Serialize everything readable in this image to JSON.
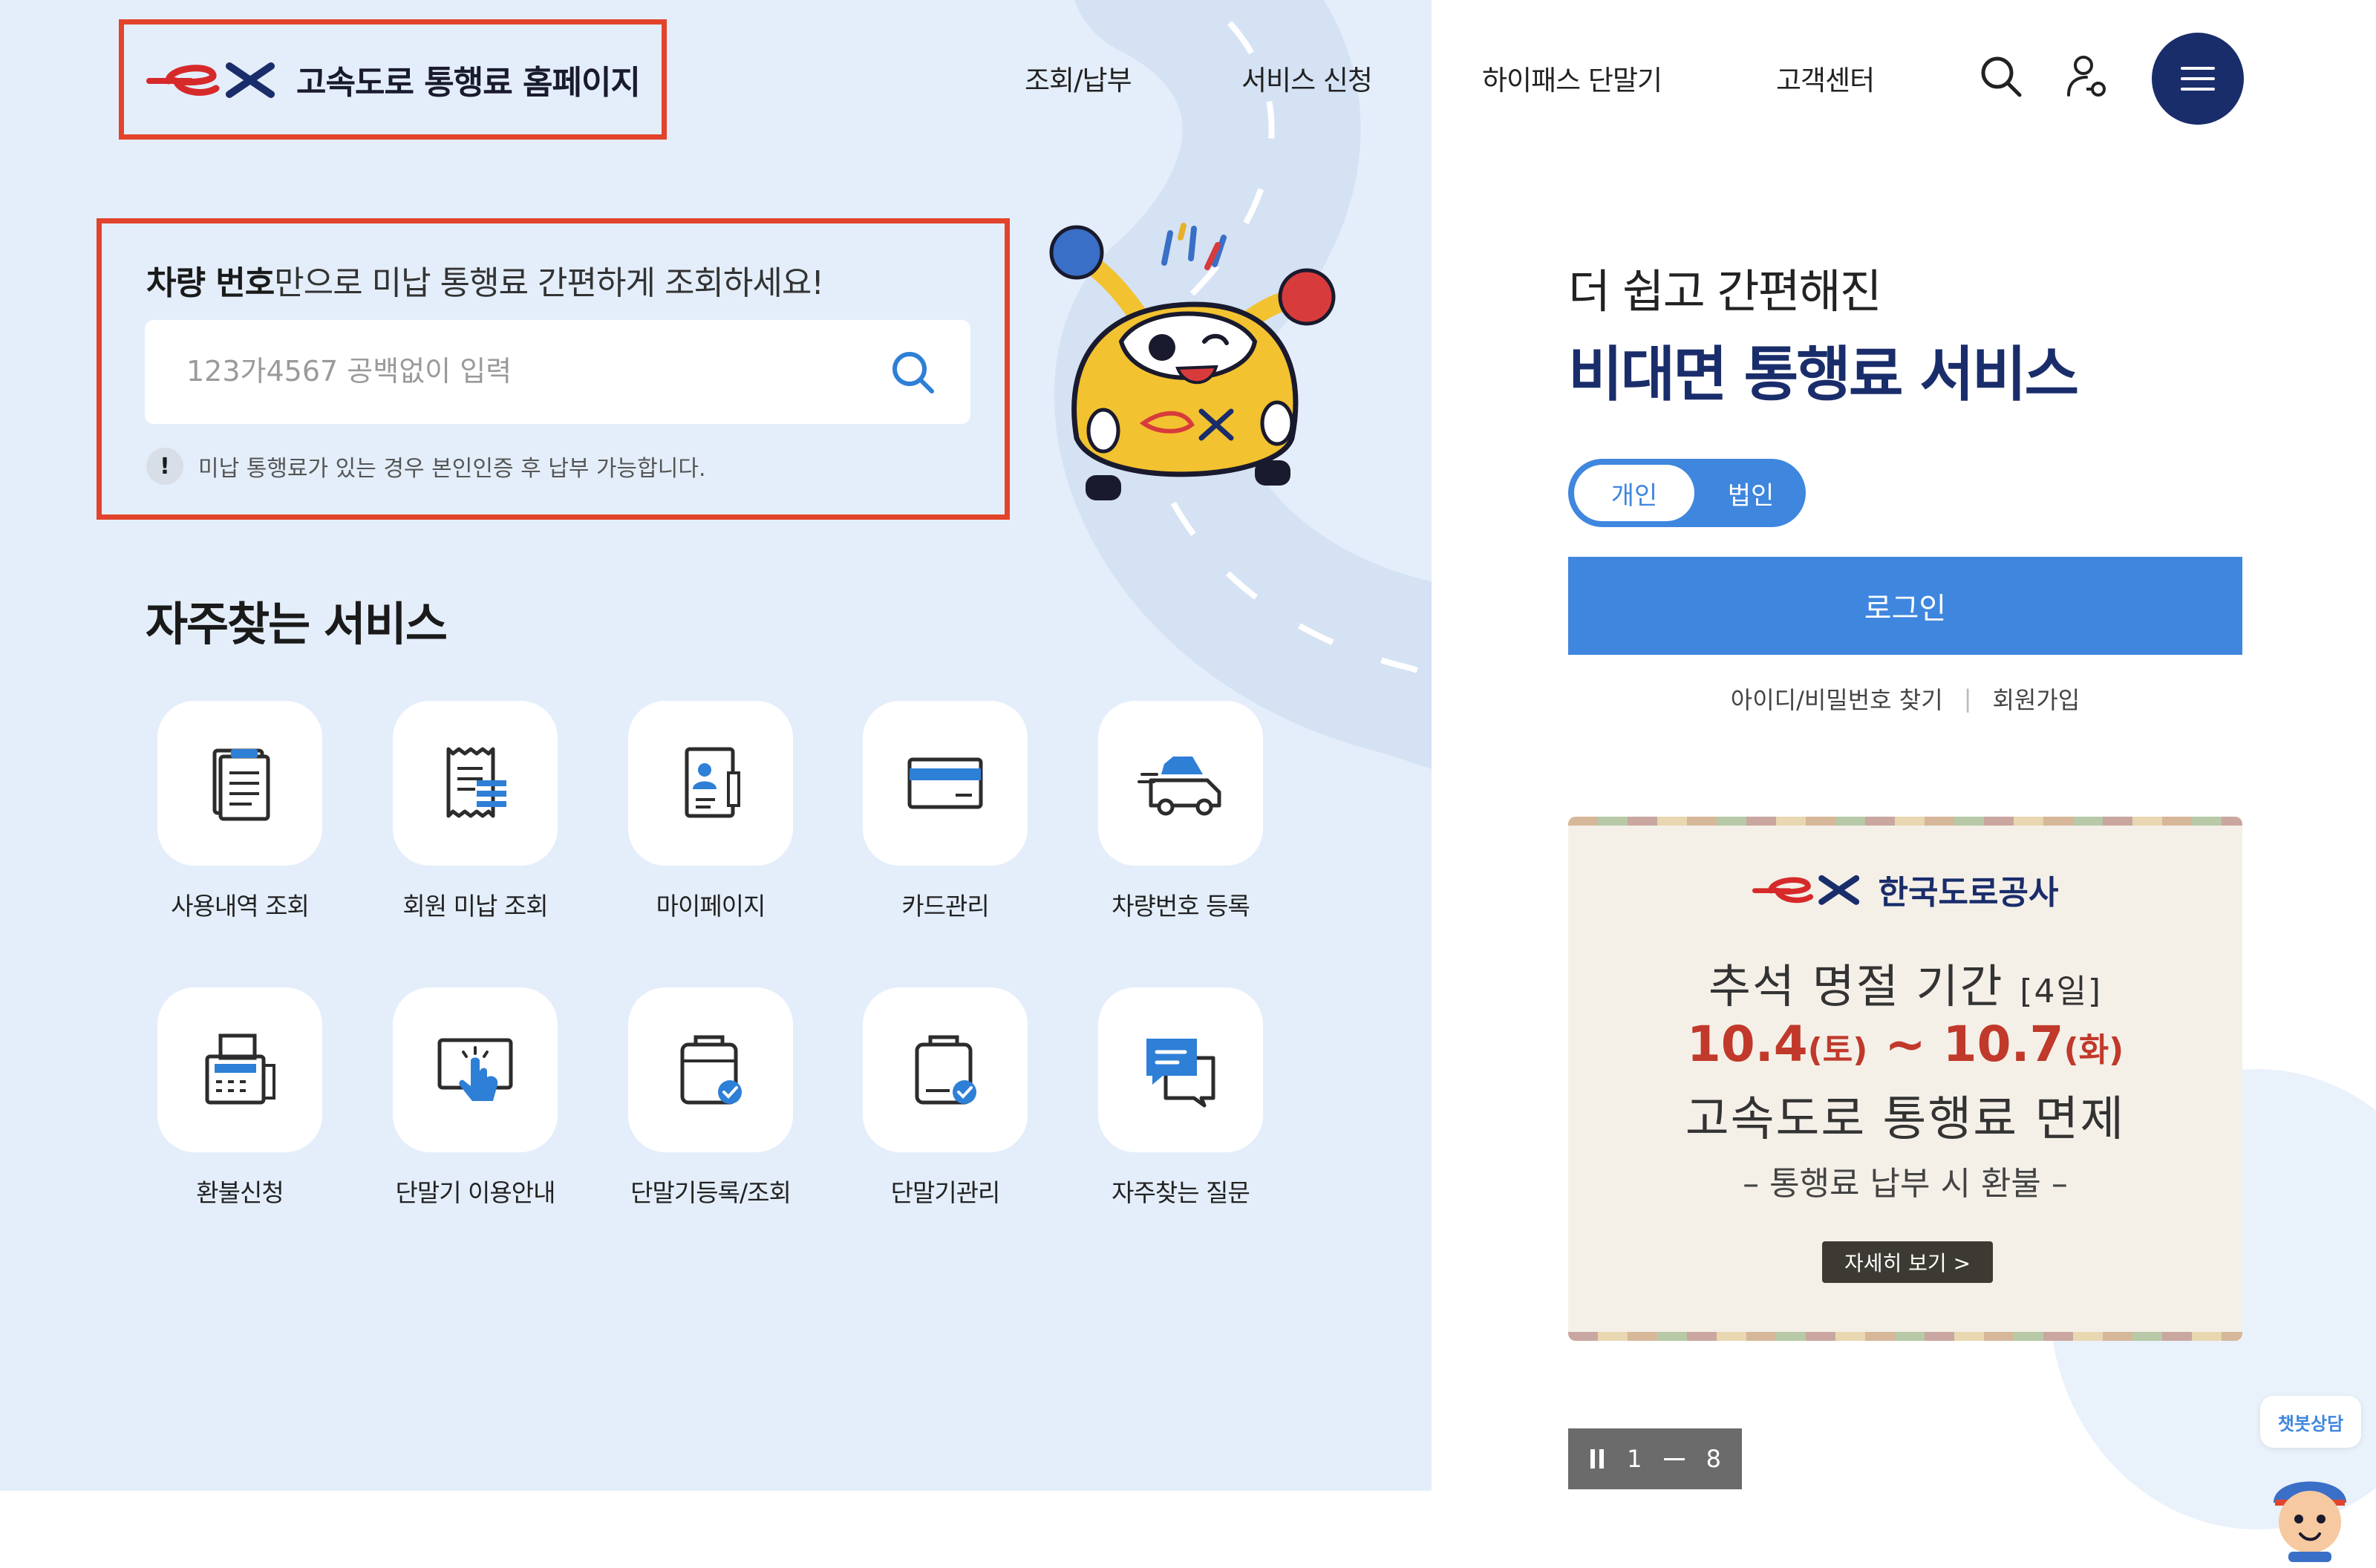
{
  "header": {
    "logo_text": "고속도로 통행료 홈페이지",
    "nav": [
      {
        "label": "조회/납부"
      },
      {
        "label": "서비스 신청"
      },
      {
        "label": "하이패스 단말기"
      },
      {
        "label": "고객센터"
      }
    ]
  },
  "search": {
    "title_bold": "차량 번호",
    "title_rest": "만으로 미납 통행료 간편하게 조회하세요!",
    "placeholder": "123가4567 공백없이 입력",
    "notice": "미납 통행료가 있는 경우 본인인증 후 납부 가능합니다."
  },
  "frequent": {
    "title": "자주찾는 서비스",
    "items": [
      {
        "label": "사용내역 조회",
        "icon": "usage-history-icon"
      },
      {
        "label": "회원 미납 조회",
        "icon": "receipt-icon"
      },
      {
        "label": "마이페이지",
        "icon": "mypage-icon"
      },
      {
        "label": "카드관리",
        "icon": "card-icon"
      },
      {
        "label": "차량번호 등록",
        "icon": "car-icon"
      },
      {
        "label": "환불신청",
        "icon": "fax-icon"
      },
      {
        "label": "단말기 이용안내",
        "icon": "touch-screen-icon"
      },
      {
        "label": "단말기등록/조회",
        "icon": "device-register-icon"
      },
      {
        "label": "단말기관리",
        "icon": "device-manage-icon"
      },
      {
        "label": "자주찾는 질문",
        "icon": "faq-chat-icon"
      }
    ]
  },
  "promo": {
    "line1": "더 쉽고 간편해진",
    "line2": "비대면 통행료 서비스",
    "toggle": {
      "personal": "개인",
      "corporate": "법인",
      "selected": "개인"
    },
    "login_label": "로그인",
    "find_account": "아이디/비밀번호 찾기",
    "signup": "회원가입"
  },
  "banner": {
    "brand": "한국도로공사",
    "period": "추석 명절 기간",
    "period_days": "[4일]",
    "date_start": "10.4",
    "date_start_day": "(토)",
    "date_sep": "~",
    "date_end": "10.7",
    "date_end_day": "(화)",
    "free_text": "고속도로 통행료 면제",
    "refund_text": "– 통행료 납부 시 환불 –",
    "more_label": "자세히 보기 >"
  },
  "pager": {
    "current": "1",
    "total": "8"
  },
  "chatbot": {
    "label": "챗봇상담"
  },
  "colors": {
    "accent_blue": "#3f86de",
    "navy": "#1a2d6b",
    "highlight_red": "#e2432b",
    "left_bg": "#e4eefa"
  }
}
